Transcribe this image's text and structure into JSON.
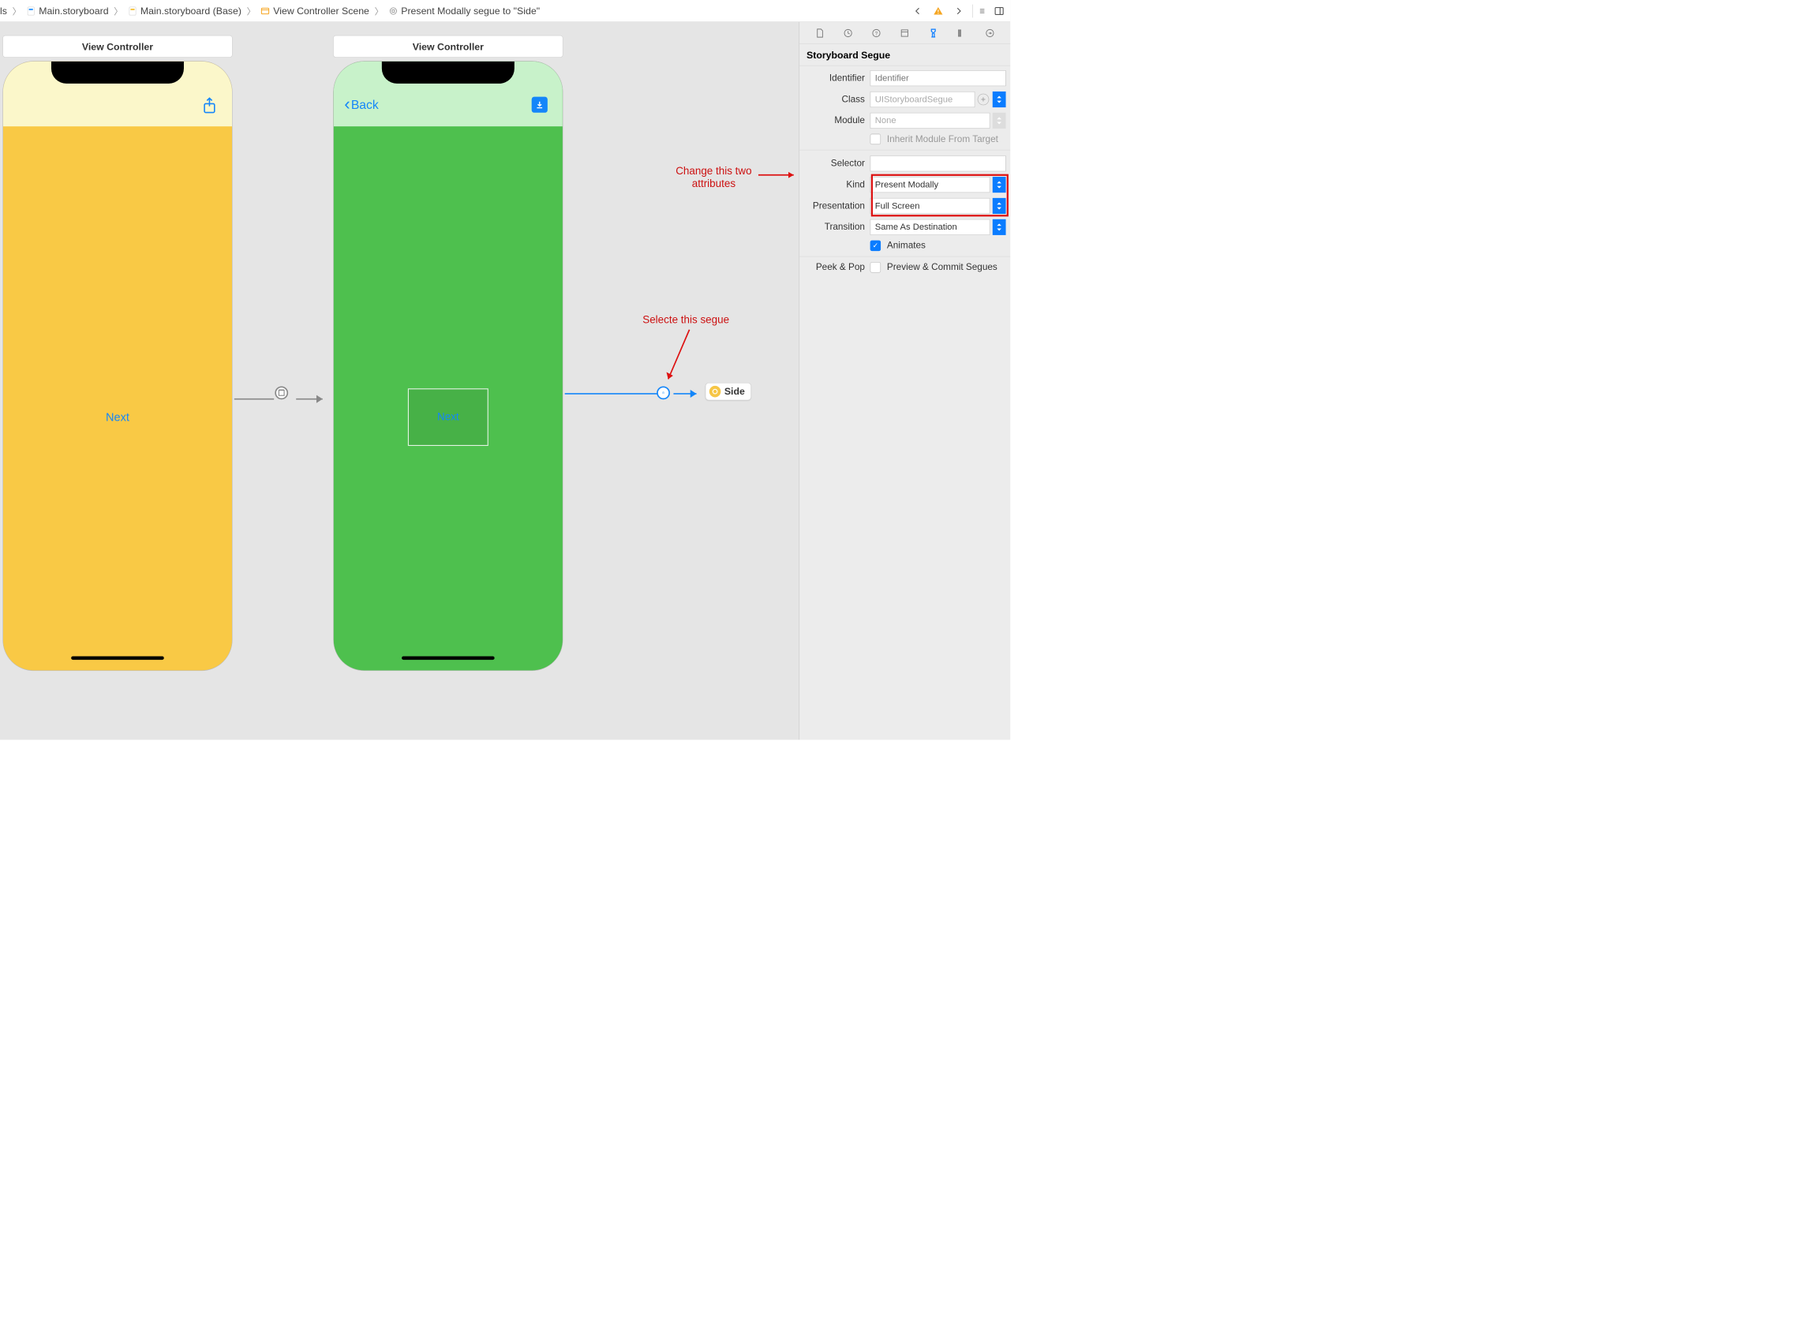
{
  "breadcrumb": {
    "b0": "ls",
    "b1": "Main.storyboard",
    "b2": "Main.storyboard (Base)",
    "b3": "View Controller Scene",
    "b4": "Present Modally segue to \"Side\""
  },
  "canvas": {
    "vc1_title": "View Controller",
    "vc2_title": "View Controller",
    "vc1_button": "Next",
    "vc2_back": "Back",
    "vc2_button": "Next",
    "side_label": "Side",
    "annotation_attrs": "Change this two attributes",
    "annotation_segue": "Selecte this segue"
  },
  "inspector": {
    "section": "Storyboard Segue",
    "labels": {
      "identifier": "Identifier",
      "class": "Class",
      "module": "Module",
      "inherit": "Inherit Module From Target",
      "selector": "Selector",
      "kind": "Kind",
      "presentation": "Presentation",
      "transition": "Transition",
      "animates": "Animates",
      "peekpop": "Peek & Pop",
      "preview": "Preview & Commit Segues"
    },
    "values": {
      "identifier_ph": "Identifier",
      "class_ph": "UIStoryboardSegue",
      "module": "None",
      "kind": "Present Modally",
      "presentation": "Full Screen",
      "transition": "Same As Destination"
    }
  }
}
